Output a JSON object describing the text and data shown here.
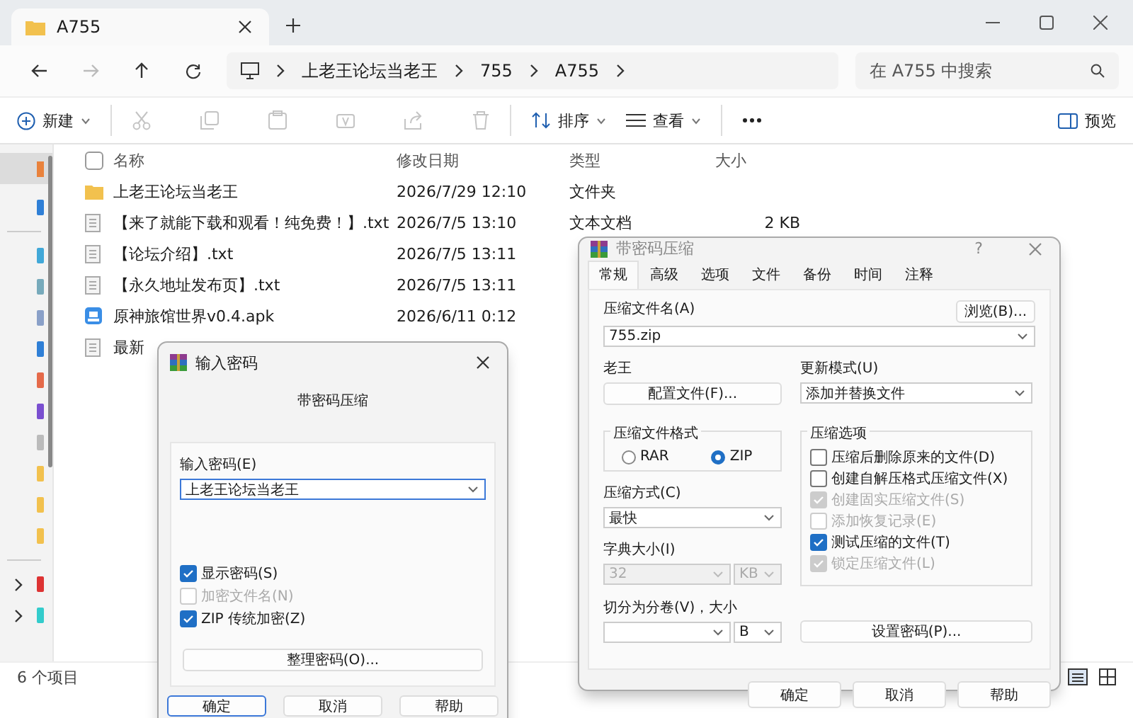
{
  "window": {
    "tab_title": "A755"
  },
  "address_bar": {
    "crumbs": [
      "上老王论坛当老王",
      "755",
      "A755"
    ]
  },
  "search": {
    "placeholder": "在 A755 中搜索"
  },
  "toolbar": {
    "new": "新建",
    "sort": "排序",
    "view": "查看",
    "preview": "预览"
  },
  "file_list": {
    "select_all_checked": false,
    "columns": [
      "名称",
      "修改日期",
      "类型",
      "大小"
    ],
    "rows": [
      {
        "kind": "folder",
        "name": "上老王论坛当老王",
        "modified": "2026/7/29 12:10",
        "type": "文件夹"
      },
      {
        "kind": "text",
        "name": "【来了就能下载和观看！纯免费！】.txt",
        "modified": "2026/7/5 13:10",
        "type": "文本文档",
        "size": "2 KB"
      },
      {
        "kind": "text",
        "name": "【论坛介绍】.txt",
        "modified": "2026/7/5 13:11"
      },
      {
        "kind": "text",
        "name": "【永久地址发布页】.txt",
        "modified": "2026/7/5 13:11"
      },
      {
        "kind": "apk",
        "name": "原神旅馆世界v0.4.apk",
        "modified": "2026/6/11 0:12"
      },
      {
        "kind": "text",
        "name": "最新"
      }
    ]
  },
  "status_bar": {
    "item_count": "6 个项目"
  },
  "password_dialog": {
    "title": "输入密码",
    "heading": "带密码压缩",
    "field_label": "输入密码(E)",
    "password": "上老王论坛当老王",
    "options": [
      {
        "label": "显示密码(S)",
        "checked": true,
        "disabled": false
      },
      {
        "label": "加密文件名(N)",
        "checked": false,
        "disabled": true
      },
      {
        "label": "ZIP 传统加密(Z)",
        "checked": true,
        "disabled": false
      }
    ],
    "organize_button": "整理密码(O)...",
    "buttons": [
      {
        "label": "确定",
        "default": true
      },
      {
        "label": "取消",
        "default": false
      },
      {
        "label": "帮助",
        "default": false
      }
    ]
  },
  "archive_dialog": {
    "title": "带密码压缩",
    "help": "?",
    "tabs": [
      {
        "label": "常规",
        "selected": true
      },
      {
        "label": "高级",
        "selected": false
      },
      {
        "label": "选项",
        "selected": false
      },
      {
        "label": "文件",
        "selected": false
      },
      {
        "label": "备份",
        "selected": false
      },
      {
        "label": "时间",
        "selected": false
      },
      {
        "label": "注释",
        "selected": false
      }
    ],
    "archive_name_label": "压缩文件名(A)",
    "browse_button": "浏览(B)...",
    "archive_name": "755.zip",
    "profiles_label": "老王",
    "profiles_button": "配置文件(F)...",
    "update_mode_label": "更新模式(U)",
    "update_mode": "添加并替换文件",
    "format_label": "压缩文件格式",
    "formats": [
      {
        "label": "RAR",
        "selected": false
      },
      {
        "label": "ZIP",
        "selected": true
      }
    ],
    "method_label": "压缩方式(C)",
    "method": "最快",
    "dictionary_label": "字典大小(I)",
    "dictionary": {
      "value": "32",
      "unit": "KB",
      "disabled": true
    },
    "split_label": "切分为分卷(V)，大小",
    "split_unit": "B",
    "options_label": "压缩选项",
    "options": [
      {
        "label": "压缩后删除原来的文件(D)",
        "checked": false,
        "disabled": false
      },
      {
        "label": "创建自解压格式压缩文件(X)",
        "checked": false,
        "disabled": false
      },
      {
        "label": "创建固实压缩文件(S)",
        "checked": true,
        "disabled": true
      },
      {
        "label": "添加恢复记录(E)",
        "checked": false,
        "disabled": true
      },
      {
        "label": "测试压缩的文件(T)",
        "checked": true,
        "disabled": false
      },
      {
        "label": "锁定压缩文件(L)",
        "checked": true,
        "disabled": true
      }
    ],
    "set_password_button": "设置密码(P)...",
    "buttons": [
      {
        "label": "确定",
        "default": false
      },
      {
        "label": "取消",
        "default": false
      },
      {
        "label": "帮助",
        "default": false
      }
    ]
  }
}
